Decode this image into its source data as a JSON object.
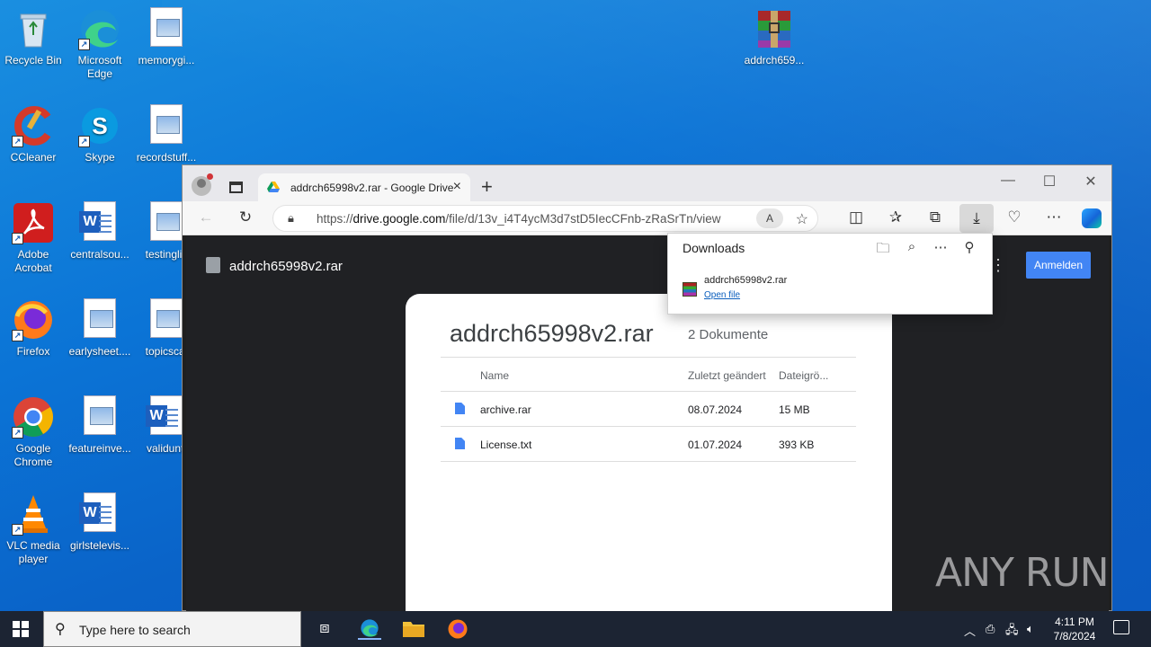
{
  "desktop": {
    "icons": [
      {
        "label": "Recycle Bin"
      },
      {
        "label": "Microsoft Edge"
      },
      {
        "label": "memorygi..."
      },
      {
        "label": "CCleaner"
      },
      {
        "label": "Skype"
      },
      {
        "label": "recordstuff..."
      },
      {
        "label": "Adobe Acrobat"
      },
      {
        "label": "centralsou..."
      },
      {
        "label": "testinglis"
      },
      {
        "label": "Firefox"
      },
      {
        "label": "earlysheet...."
      },
      {
        "label": "topicscal"
      },
      {
        "label": "Google Chrome"
      },
      {
        "label": "featureinve..."
      },
      {
        "label": "validunti"
      },
      {
        "label": "VLC media player"
      },
      {
        "label": "girlstelevis..."
      },
      {
        "label": "addrch659..."
      }
    ]
  },
  "browser": {
    "tab_title": "addrch65998v2.rar - Google Drive",
    "url_prefix": "https://",
    "url_host": "drive.google.com",
    "url_path": "/file/d/13v_i4T4ycM3d7stD5IecCFnb-zRaSrTn/view",
    "read_aloud": "A",
    "window_controls": {
      "minimize": "—",
      "maximize": "☐",
      "close": "✕"
    }
  },
  "viewer": {
    "file_name": "addrch65998v2.rar",
    "signin_label": "Anmelden",
    "card_title": "addrch65998v2.rar",
    "doc_count": "2 Dokumente",
    "columns": [
      "Name",
      "Zuletzt geändert",
      "Dateigrö..."
    ],
    "rows": [
      {
        "name": "archive.rar",
        "modified": "08.07.2024",
        "size": "15 MB"
      },
      {
        "name": "License.txt",
        "modified": "01.07.2024",
        "size": "393 KB"
      }
    ]
  },
  "downloads": {
    "title": "Downloads",
    "file_name": "addrch65998v2.rar",
    "action": "Open file"
  },
  "taskbar": {
    "search_placeholder": "Type here to search",
    "time": "4:11 PM",
    "date": "7/8/2024"
  },
  "watermark": "ANY RUN"
}
